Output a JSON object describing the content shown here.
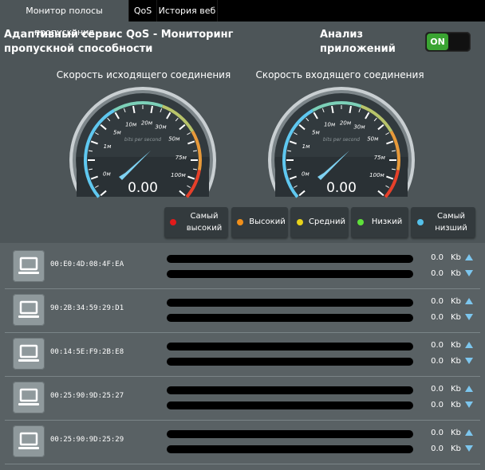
{
  "tabs": [
    {
      "label": "Монитор полосы пропускания"
    },
    {
      "label": "QoS"
    },
    {
      "label": "История веб"
    }
  ],
  "header": {
    "title": "Адаптивный сервис QoS - Мониторинг пропускной способности",
    "analysis_label": "Анализ приложений",
    "toggle_label": "ON"
  },
  "gauges": [
    {
      "title": "Скорость исходящего соединения",
      "value": "0.00",
      "unit_caption": "bits per second",
      "scale": [
        "0м",
        "1м",
        "5м",
        "10м",
        "20м",
        "30м",
        "50м",
        "75м",
        "100м"
      ]
    },
    {
      "title": "Скорость входящего соединения",
      "value": "0.00",
      "unit_caption": "bits per second",
      "scale": [
        "0м",
        "1м",
        "5м",
        "10м",
        "20м",
        "30м",
        "50м",
        "75м",
        "100м"
      ]
    }
  ],
  "priorities": [
    {
      "label": "Самый высокий",
      "color": "#e21a1a"
    },
    {
      "label": "Высокий",
      "color": "#f08f1a"
    },
    {
      "label": "Средний",
      "color": "#e8d21a"
    },
    {
      "label": "Низкий",
      "color": "#5ee03a"
    },
    {
      "label": "Самый низший",
      "color": "#54c0ea"
    }
  ],
  "clients": [
    {
      "mac": "00:E0:4D:08:4F:EA",
      "up": "0.0",
      "down": "0.0",
      "unit": "Kb"
    },
    {
      "mac": "90:2B:34:59:29:D1",
      "up": "0.0",
      "down": "0.0",
      "unit": "Kb"
    },
    {
      "mac": "00:14:5E:F9:2B:E8",
      "up": "0.0",
      "down": "0.0",
      "unit": "Kb"
    },
    {
      "mac": "00:25:90:9D:25:27",
      "up": "0.0",
      "down": "0.0",
      "unit": "Kb"
    },
    {
      "mac": "00:25:90:9D:25:29",
      "up": "0.0",
      "down": "0.0",
      "unit": "Kb"
    }
  ]
}
